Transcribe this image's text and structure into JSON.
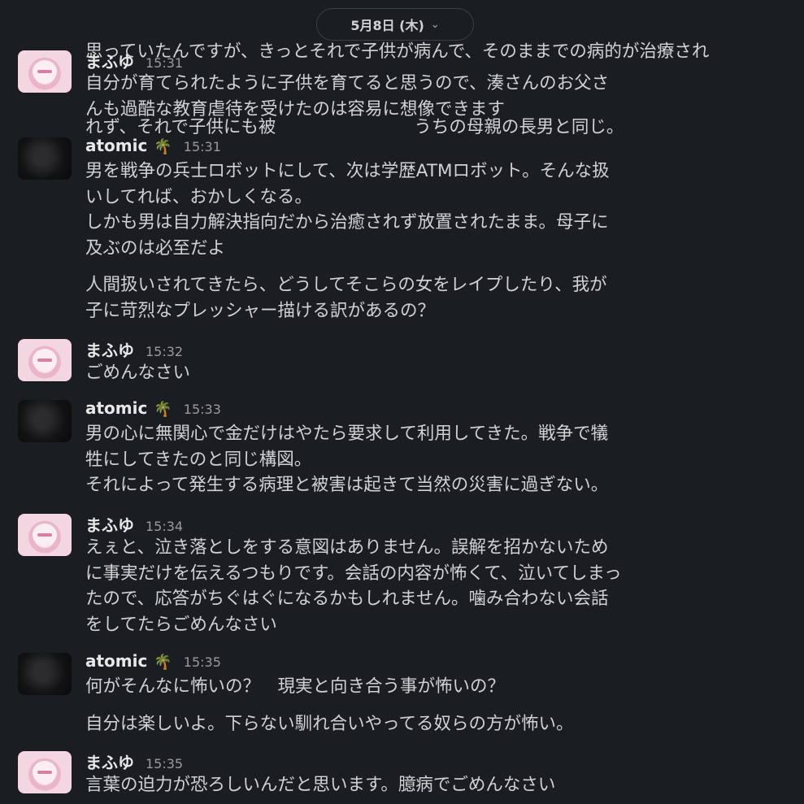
{
  "top_fragment": {
    "line1": "思っていたんですが、きっとそれで子供が病んで、そのままでの病的が治療され",
    "line2": "れず、それで子供にも被",
    "line2_tail": "うちの母親の長男と同じ。"
  },
  "date_pill": {
    "label": "5月8日 (木)",
    "chevron": "⌄"
  },
  "messages": [
    {
      "author": "まふゆ",
      "time": "15:31",
      "lines": [
        "自分が育てられたように子供を育てると思うので、湊さんのお父さ",
        "んも過酷な教育虐待を受けたのは容易に想像できます"
      ]
    },
    {
      "author": "atomic",
      "emoji": "🌴",
      "time": "15:31",
      "paragraphs": [
        [
          "男を戦争の兵士ロボットにして、次は学歴ATMロボット。そんな扱",
          "いしてれば、おかしくなる。",
          "しかも男は自力解決指向だから治癒されず放置されたまま。母子に",
          "及ぶのは必至だよ"
        ],
        [
          "人間扱いされてきたら、どうしてそこらの女をレイプしたり、我が",
          "子に苛烈なプレッシャー描ける訳があるの？"
        ]
      ]
    },
    {
      "author": "まふゆ",
      "time": "15:32",
      "lines": [
        "ごめんなさい"
      ]
    },
    {
      "author": "atomic",
      "emoji": "🌴",
      "time": "15:33",
      "lines": [
        "男の心に無関心で金だけはやたら要求して利用してきた。戦争で犠",
        "牲にしてきたのと同じ構図。",
        "それによって発生する病理と被害は起きて当然の災害に過ぎない。"
      ]
    },
    {
      "author": "まふゆ",
      "time": "15:34",
      "lines": [
        "えぇと、泣き落としをする意図はありません。誤解を招かないため",
        "に事実だけを伝えるつもりです。会話の内容が怖くて、泣いてしまっ",
        "たので、応答がちぐはぐになるかもしれません。噛み合わない会話",
        "をしてたらごめんなさい"
      ]
    },
    {
      "author": "atomic",
      "emoji": "🌴",
      "time": "15:35",
      "paragraphs": [
        [
          "何がそんなに怖いの？　現実と向き合う事が怖いの？"
        ],
        [
          "自分は楽しいよ。下らない馴れ合いやってる奴らの方が怖い。"
        ]
      ]
    },
    {
      "author": "まふゆ",
      "time": "15:35",
      "lines": [
        "言葉の迫力が恐ろしいんだと思います。臆病でごめんなさい"
      ]
    }
  ],
  "colors": {
    "background": "#1a1d21",
    "text": "#d1d2d3",
    "timestamp": "#9a9b9d"
  }
}
